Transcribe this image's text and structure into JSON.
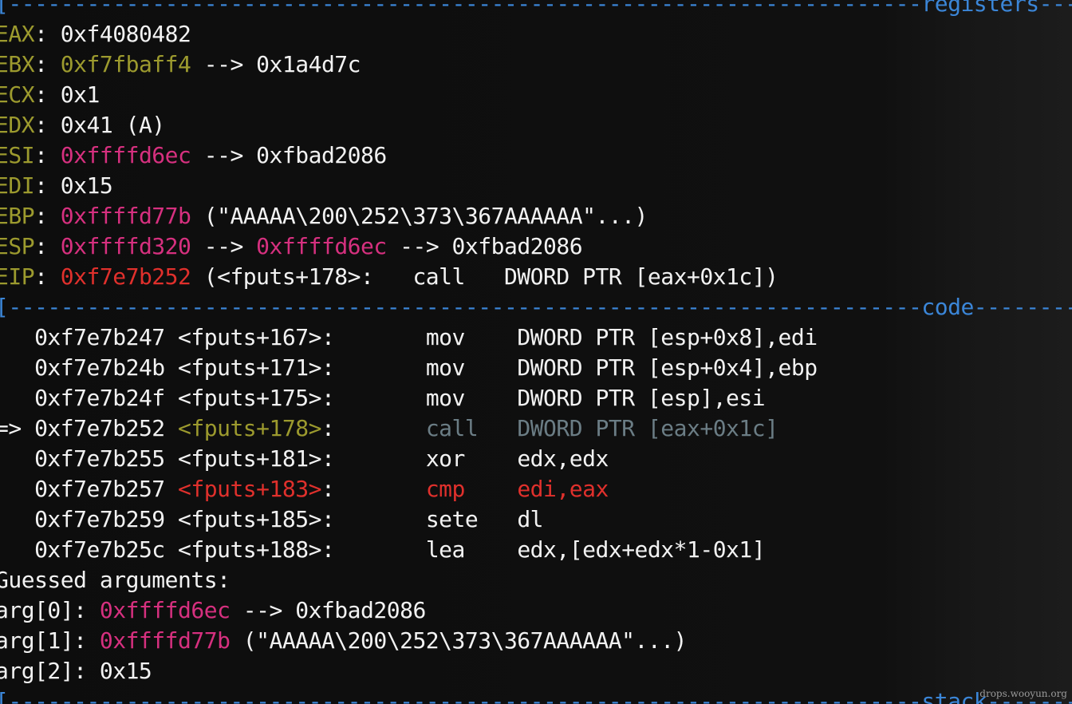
{
  "watermark": "drops.wooyun.org",
  "separators": {
    "registers": "[----------------------------------------------------------------------registers-----",
    "code": "[----------------------------------------------------------------------code--------",
    "stack": "[----------------------------------------------------------------------stack-------"
  },
  "registers": [
    {
      "name": "EAX",
      "segments": [
        {
          "t": ": ",
          "c": "white"
        },
        {
          "t": "0xf4080482",
          "c": "white"
        }
      ]
    },
    {
      "name": "EBX",
      "segments": [
        {
          "t": ": ",
          "c": "white"
        },
        {
          "t": "0xf7fbaff4",
          "c": "olive"
        },
        {
          "t": " --> 0x1a4d7c",
          "c": "white"
        }
      ]
    },
    {
      "name": "ECX",
      "segments": [
        {
          "t": ": ",
          "c": "white"
        },
        {
          "t": "0x1",
          "c": "white"
        }
      ]
    },
    {
      "name": "EDX",
      "segments": [
        {
          "t": ": ",
          "c": "white"
        },
        {
          "t": "0x41 (A)",
          "c": "white"
        }
      ]
    },
    {
      "name": "ESI",
      "segments": [
        {
          "t": ": ",
          "c": "white"
        },
        {
          "t": "0xffffd6ec",
          "c": "pink"
        },
        {
          "t": " --> 0xfbad2086",
          "c": "white"
        }
      ]
    },
    {
      "name": "EDI",
      "segments": [
        {
          "t": ": ",
          "c": "white"
        },
        {
          "t": "0x15",
          "c": "white"
        }
      ]
    },
    {
      "name": "EBP",
      "segments": [
        {
          "t": ": ",
          "c": "white"
        },
        {
          "t": "0xffffd77b",
          "c": "pink"
        },
        {
          "t": " (\"AAAAA\\200\\252\\373\\367AAAAAA\"...)",
          "c": "white"
        }
      ]
    },
    {
      "name": "ESP",
      "segments": [
        {
          "t": ": ",
          "c": "white"
        },
        {
          "t": "0xffffd320",
          "c": "pink"
        },
        {
          "t": " --> ",
          "c": "white"
        },
        {
          "t": "0xffffd6ec",
          "c": "pink"
        },
        {
          "t": " --> 0xfbad2086",
          "c": "white"
        }
      ]
    },
    {
      "name": "EIP",
      "segments": [
        {
          "t": ": ",
          "c": "white"
        },
        {
          "t": "0xf7e7b252",
          "c": "red"
        },
        {
          "t": " (<fputs+178>:   call   DWORD PTR [eax+0x1c])",
          "c": "white"
        }
      ]
    }
  ],
  "code": [
    {
      "marker": "   ",
      "addr": "0xf7e7b247",
      "sym": "<fputs+167>",
      "sym_c": "white",
      "op": "mov",
      "args": "DWORD PTR [esp+0x8],edi",
      "op_c": "white"
    },
    {
      "marker": "   ",
      "addr": "0xf7e7b24b",
      "sym": "<fputs+171>",
      "sym_c": "white",
      "op": "mov",
      "args": "DWORD PTR [esp+0x4],ebp",
      "op_c": "white"
    },
    {
      "marker": "   ",
      "addr": "0xf7e7b24f",
      "sym": "<fputs+175>",
      "sym_c": "white",
      "op": "mov",
      "args": "DWORD PTR [esp],esi",
      "op_c": "white"
    },
    {
      "marker": "=> ",
      "addr": "0xf7e7b252",
      "sym": "<fputs+178>",
      "sym_c": "olive",
      "op": "call",
      "args": "DWORD PTR [eax+0x1c]",
      "op_c": "dim"
    },
    {
      "marker": "   ",
      "addr": "0xf7e7b255",
      "sym": "<fputs+181>",
      "sym_c": "white",
      "op": "xor",
      "args": "edx,edx",
      "op_c": "white"
    },
    {
      "marker": "   ",
      "addr": "0xf7e7b257",
      "sym": "<fputs+183>",
      "sym_c": "red",
      "op": "cmp",
      "args": "edi,eax",
      "op_c": "red"
    },
    {
      "marker": "   ",
      "addr": "0xf7e7b259",
      "sym": "<fputs+185>",
      "sym_c": "white",
      "op": "sete",
      "args": "dl",
      "op_c": "white"
    },
    {
      "marker": "   ",
      "addr": "0xf7e7b25c",
      "sym": "<fputs+188>",
      "sym_c": "white",
      "op": "lea",
      "args": "edx,[edx+edx*1-0x1]",
      "op_c": "white"
    }
  ],
  "guessed": {
    "title": "Guessed arguments:",
    "args": [
      {
        "label": "arg[0]: ",
        "value": "0xffffd6ec",
        "value_c": "pink",
        "rest": " --> 0xfbad2086"
      },
      {
        "label": "arg[1]: ",
        "value": "0xffffd77b",
        "value_c": "pink",
        "rest": " (\"AAAAA\\200\\252\\373\\367AAAAAA\"...)"
      },
      {
        "label": "arg[2]: ",
        "value": "0x15",
        "value_c": "white",
        "rest": ""
      }
    ]
  },
  "colors": {
    "white": "#f2f2f2",
    "olive": "#9c9a2e",
    "pink": "#d6307f",
    "red": "#e0302c",
    "blue": "#3b86d8",
    "dim": "#6b7d85"
  }
}
